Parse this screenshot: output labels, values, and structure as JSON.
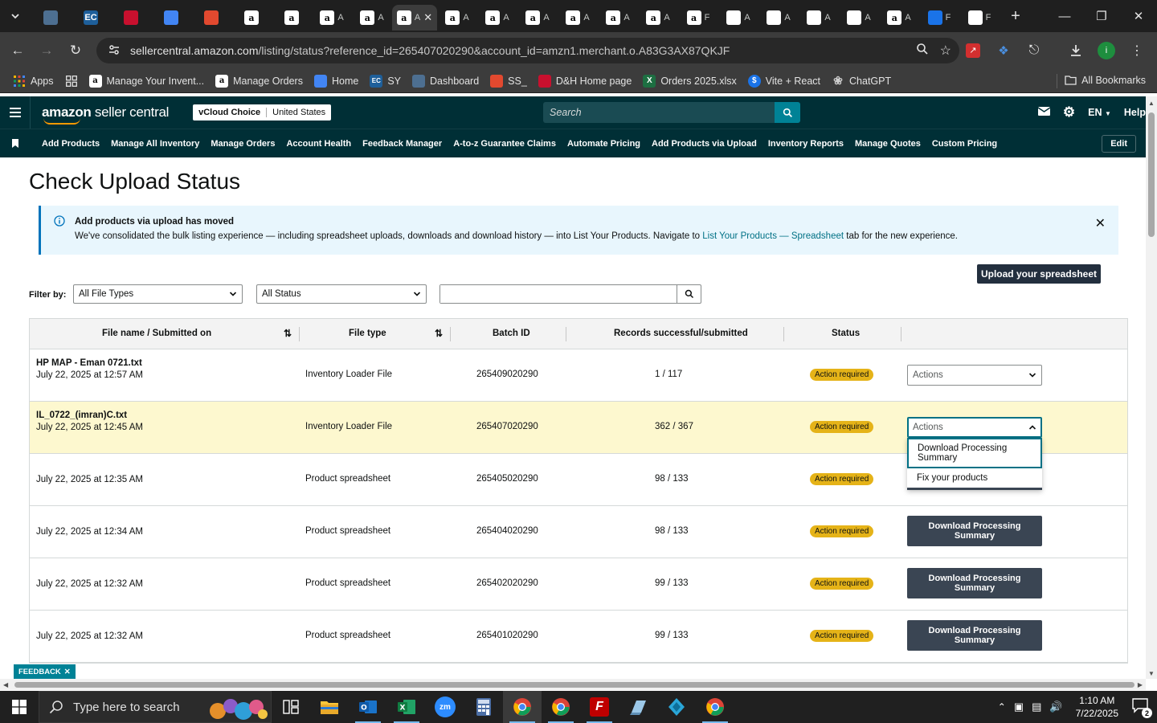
{
  "browser": {
    "tabs": [
      {
        "icon": "settings-tab-icon",
        "color": "#4d6f91",
        "label": ""
      },
      {
        "icon": "ec-tab-icon",
        "color": "#1e5f9a",
        "label": "EC"
      },
      {
        "icon": "dh-tab-icon",
        "color": "#c8102e",
        "label": ""
      },
      {
        "icon": "home-tab-icon",
        "color": "#4285f4",
        "label": ""
      },
      {
        "icon": "ss-tab-icon",
        "color": "#e2492f",
        "label": ""
      },
      {
        "icon": "amazon-tab-icon",
        "color": "#ffffff",
        "label": "a"
      },
      {
        "icon": "amazon-tab-icon",
        "color": "#ffffff",
        "label": "a"
      },
      {
        "icon": "amazon-tab-icon",
        "color": "#ffffff",
        "label": "a",
        "name": "A"
      },
      {
        "icon": "amazon-tab-icon",
        "color": "#ffffff",
        "label": "a",
        "name": "A"
      },
      {
        "icon": "amazon-tab-icon",
        "color": "#ffffff",
        "label": "a",
        "name": "A",
        "active": true
      },
      {
        "icon": "amazon-tab-icon",
        "color": "#ffffff",
        "label": "a",
        "name": "A"
      },
      {
        "icon": "amazon-tab-icon",
        "color": "#ffffff",
        "label": "a",
        "name": "A"
      },
      {
        "icon": "amazon-tab-icon",
        "color": "#ffffff",
        "label": "a",
        "name": "A"
      },
      {
        "icon": "amazon-tab-icon",
        "color": "#ffffff",
        "label": "a",
        "name": "A"
      },
      {
        "icon": "amazon-tab-icon",
        "color": "#ffffff",
        "label": "a",
        "name": "A"
      },
      {
        "icon": "amazon-tab-icon",
        "color": "#ffffff",
        "label": "a",
        "name": "A"
      },
      {
        "icon": "amazon-tab-icon",
        "color": "#ffffff",
        "label": "a",
        "name": "F"
      },
      {
        "icon": "openai-tab-icon",
        "color": "#ffffff",
        "label": "",
        "name": "A"
      },
      {
        "icon": "openai-tab-icon",
        "color": "#ffffff",
        "label": "",
        "name": "A"
      },
      {
        "icon": "openai-tab-icon",
        "color": "#ffffff",
        "label": "",
        "name": "A"
      },
      {
        "icon": "openai-tab-icon",
        "color": "#ffffff",
        "label": "",
        "name": "A"
      },
      {
        "icon": "amazon-tab-icon",
        "color": "#ffffff",
        "label": "a",
        "name": "A"
      },
      {
        "icon": "dollar-tab-icon",
        "color": "#1a73e8",
        "label": "",
        "name": "F"
      },
      {
        "icon": "chatgpt-tab-icon",
        "color": "#ffffff",
        "label": "",
        "name": "F"
      }
    ],
    "url_host": "sellercentral.amazon.com",
    "url_path": "/listing/status?reference_id=265407020290&account_id=amzn1.merchant.o.A83G3AX87QKJF",
    "bookmarks": [
      {
        "label": "Apps",
        "icon": "apps-grid-icon",
        "color": "#f4b400"
      },
      {
        "label": "",
        "icon": "tab-groups-icon",
        "color": "#e3e3e3"
      },
      {
        "label": "Manage Your Invent...",
        "icon": "amazon-icon",
        "color": "#ffffff"
      },
      {
        "label": "Manage Orders",
        "icon": "amazon-icon",
        "color": "#ffffff"
      },
      {
        "label": "Home",
        "icon": "home-page-icon",
        "color": "#4285f4"
      },
      {
        "label": "SY",
        "icon": "ec-icon",
        "color": "#1e5f9a"
      },
      {
        "label": "Dashboard",
        "icon": "dashboard-icon",
        "color": "#4d6f91"
      },
      {
        "label": "SS_",
        "icon": "ss-icon",
        "color": "#e2492f"
      },
      {
        "label": "D&H Home page",
        "icon": "dh-icon",
        "color": "#c8102e"
      },
      {
        "label": "Orders 2025.xlsx",
        "icon": "excel-icon",
        "color": "#1d6f42"
      },
      {
        "label": "Vite + React",
        "icon": "dollar-icon",
        "color": "#1a73e8"
      },
      {
        "label": "ChatGPT",
        "icon": "chatgpt-icon",
        "color": "#cfcfcf"
      }
    ],
    "all_bookmarks": "All Bookmarks"
  },
  "header": {
    "logo_bold": "amazon",
    "logo_light": " seller central",
    "store": "vCloud Choice",
    "country": "United States",
    "search_placeholder": "Search",
    "language": "EN",
    "help": "Help"
  },
  "nav": {
    "links": [
      "Add Products",
      "Manage All Inventory",
      "Manage Orders",
      "Account Health",
      "Feedback Manager",
      "A-to-z Guarantee Claims",
      "Automate Pricing",
      "Add Products via Upload",
      "Inventory Reports",
      "Manage Quotes",
      "Custom Pricing"
    ],
    "edit": "Edit"
  },
  "page": {
    "title": "Check Upload Status",
    "info_title": "Add products via upload has moved",
    "info_text_before": "We've consolidated the bulk listing experience — including spreadsheet uploads, downloads and download history — into List Your Products. Navigate to ",
    "info_link": "List Your Products — Spreadsheet",
    "info_text_after": " tab for the new experience.",
    "upload_button": "Upload your spreadsheet",
    "filter_label": "Filter by:",
    "filter_type": "All File Types",
    "filter_status": "All Status",
    "filter_search_value": ""
  },
  "table": {
    "headers": [
      "File name / Submitted on",
      "File type",
      "Batch ID",
      "Records successful/submitted",
      "Status"
    ],
    "rows": [
      {
        "name": "HP MAP - Eman 0721.txt",
        "date": "July 22, 2025 at 12:57 AM",
        "type": "Inventory Loader File",
        "batch": "265409020290",
        "records": "1 / 117",
        "status": "Action required",
        "action": "select",
        "action_label": "Actions"
      },
      {
        "name": "IL_0722_(imran)C.txt",
        "date": "July 22, 2025 at 12:45 AM",
        "type": "Inventory Loader File",
        "batch": "265407020290",
        "records": "362 / 367",
        "status": "Action required",
        "action": "select-open",
        "action_label": "Actions",
        "highlight": true
      },
      {
        "name": "",
        "date": "July 22, 2025 at 12:35 AM",
        "type": "Product spreadsheet",
        "batch": "265405020290",
        "records": "98 / 133",
        "status": "Action required",
        "action": "hidden",
        "action_label": ""
      },
      {
        "name": "",
        "date": "July 22, 2025 at 12:34 AM",
        "type": "Product spreadsheet",
        "batch": "265404020290",
        "records": "98 / 133",
        "status": "Action required",
        "action": "button",
        "action_label": "Download Processing Summary"
      },
      {
        "name": "",
        "date": "July 22, 2025 at 12:32 AM",
        "type": "Product spreadsheet",
        "batch": "265402020290",
        "records": "99 / 133",
        "status": "Action required",
        "action": "button",
        "action_label": "Download Processing Summary"
      },
      {
        "name": "",
        "date": "July 22, 2025 at 12:32 AM",
        "type": "Product spreadsheet",
        "batch": "265401020290",
        "records": "99 / 133",
        "status": "Action required",
        "action": "button",
        "action_label": "Download Processing Summary"
      }
    ],
    "dropdown": [
      "Download Processing Summary",
      "Fix your products"
    ]
  },
  "feedback": "FEEDBACK",
  "taskbar": {
    "search_placeholder": "Type here to search",
    "time": "1:10 AM",
    "date": "7/22/2025",
    "notifications": "2"
  },
  "colors": {
    "sc_header": "#002f36",
    "badge": "#e5b318",
    "button_dark": "#3a4553",
    "link": "#007185"
  }
}
